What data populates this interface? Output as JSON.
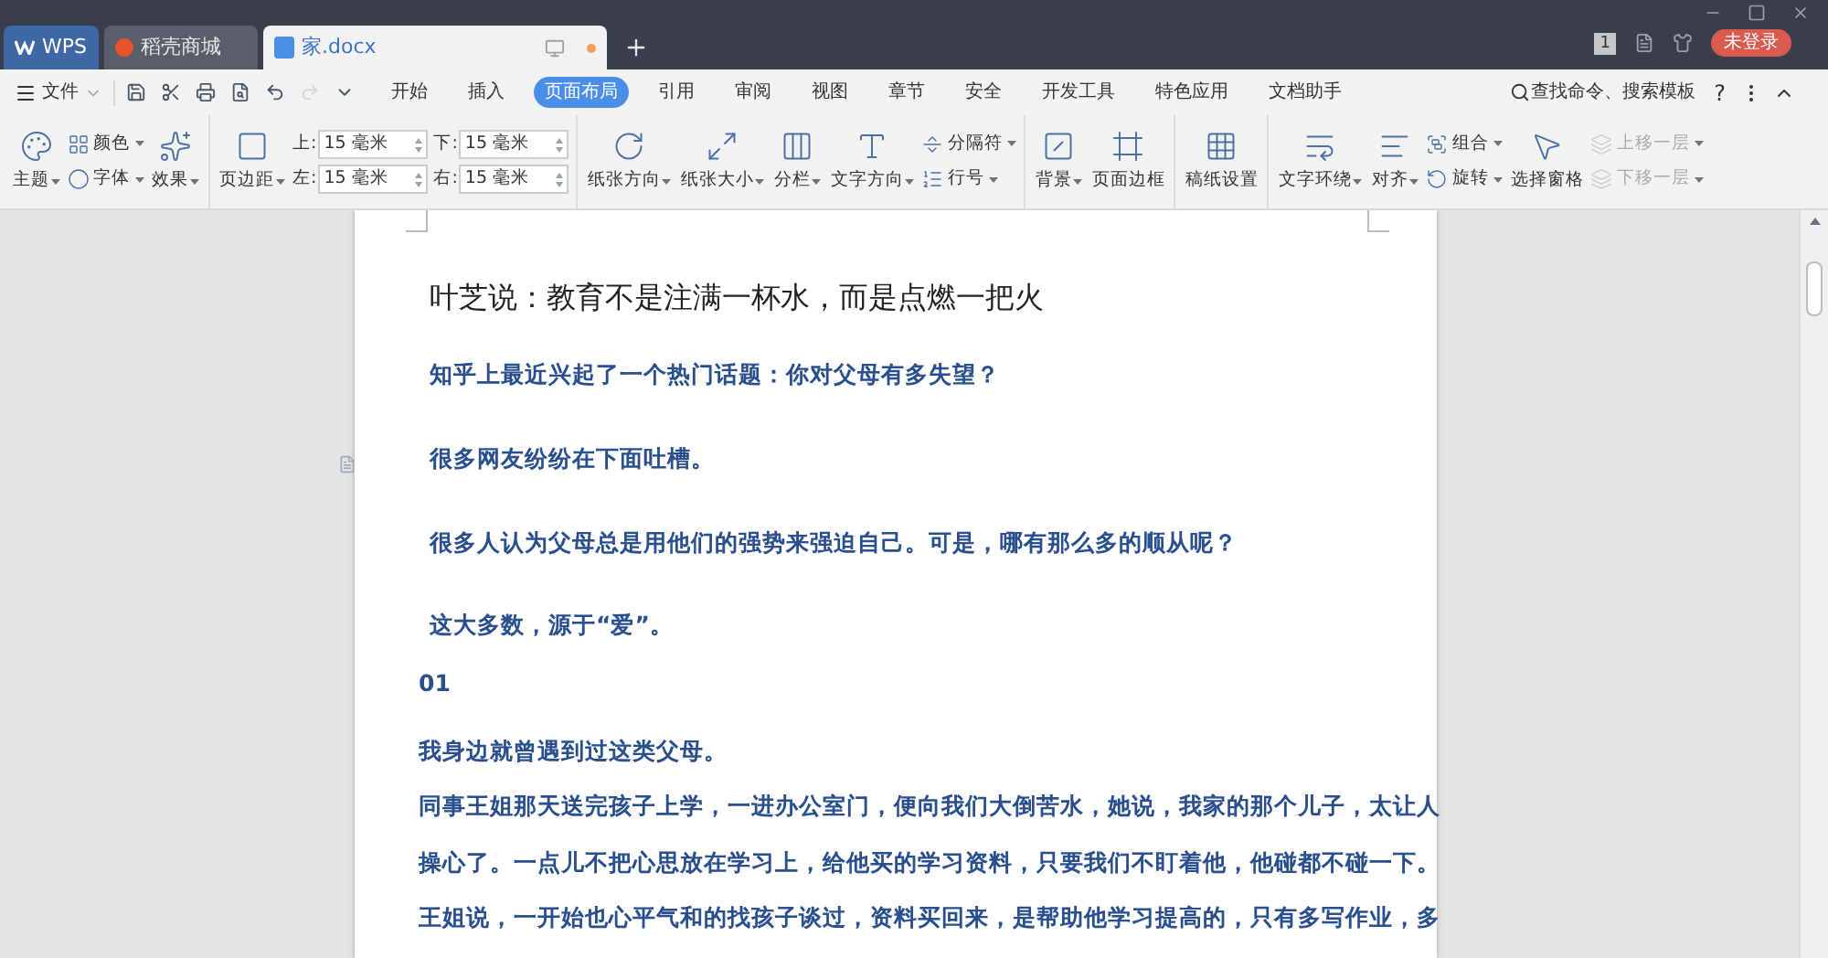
{
  "title_tabs": [
    {
      "label": "WPS",
      "selected": false,
      "kind": "home"
    },
    {
      "label": "稻壳商城",
      "selected": false,
      "kind": "store"
    },
    {
      "label": "家.docx",
      "selected": true,
      "kind": "doc"
    }
  ],
  "title_right": {
    "badge": "1",
    "login": "未登录"
  },
  "menu": {
    "file": "文件",
    "tabs": [
      {
        "label": "开始",
        "selected": false
      },
      {
        "label": "插入",
        "selected": false
      },
      {
        "label": "页面布局",
        "selected": true
      },
      {
        "label": "引用",
        "selected": false
      },
      {
        "label": "审阅",
        "selected": false
      },
      {
        "label": "视图",
        "selected": false
      },
      {
        "label": "章节",
        "selected": false
      },
      {
        "label": "安全",
        "selected": false
      },
      {
        "label": "开发工具",
        "selected": false
      },
      {
        "label": "特色应用",
        "selected": false
      },
      {
        "label": "文档助手",
        "selected": false
      }
    ],
    "search": "查找命令、搜索模板",
    "help": "?"
  },
  "ribbon": [
    {
      "columns": [
        {
          "kind": "large",
          "label": "主题",
          "dropdown": true
        },
        {
          "kind": "stack",
          "items": [
            {
              "label": "颜色",
              "dropdown": true,
              "disabled": false
            },
            {
              "label": "字体",
              "dropdown": true,
              "disabled": false
            }
          ]
        },
        {
          "kind": "large",
          "label": "效果",
          "dropdown": true
        }
      ]
    },
    {
      "columns": [
        {
          "kind": "large",
          "label": "页边距",
          "dropdown": true
        },
        {
          "kind": "fields",
          "items": [
            {
              "label": "上:",
              "value": "15 毫米"
            },
            {
              "label": "左:",
              "value": "15 毫米"
            }
          ]
        },
        {
          "kind": "fields",
          "items": [
            {
              "label": "下:",
              "value": "15 毫米"
            },
            {
              "label": "右:",
              "value": "15 毫米"
            }
          ]
        }
      ]
    },
    {
      "columns": [
        {
          "kind": "large",
          "label": "纸张方向",
          "dropdown": true
        },
        {
          "kind": "large",
          "label": "纸张大小",
          "dropdown": true
        },
        {
          "kind": "large",
          "label": "分栏",
          "dropdown": true
        },
        {
          "kind": "large",
          "label": "文字方向",
          "dropdown": true
        },
        {
          "kind": "stack",
          "items": [
            {
              "label": "分隔符",
              "dropdown": true,
              "disabled": false
            },
            {
              "label": "行号",
              "dropdown": true,
              "disabled": false
            }
          ]
        }
      ]
    },
    {
      "columns": [
        {
          "kind": "large",
          "label": "背景",
          "dropdown": true
        },
        {
          "kind": "large",
          "label": "页面边框",
          "dropdown": false
        }
      ]
    },
    {
      "columns": [
        {
          "kind": "large",
          "label": "稿纸设置",
          "dropdown": false
        }
      ]
    },
    {
      "columns": [
        {
          "kind": "large",
          "label": "文字环绕",
          "dropdown": true
        },
        {
          "kind": "large",
          "label": "对齐",
          "dropdown": true
        },
        {
          "kind": "stack",
          "items": [
            {
              "label": "组合",
              "dropdown": true,
              "disabled": false
            },
            {
              "label": "旋转",
              "dropdown": true,
              "disabled": false
            }
          ]
        },
        {
          "kind": "large",
          "label": "选择窗格",
          "dropdown": false
        },
        {
          "kind": "stack",
          "items": [
            {
              "label": "上移一层",
              "dropdown": true,
              "disabled": true
            },
            {
              "label": "下移一层",
              "dropdown": true,
              "disabled": true
            }
          ]
        }
      ]
    }
  ],
  "document": {
    "paragraphs": [
      {
        "kind": "heading",
        "lines": [
          "叶芝说：教育不是注满一杯水，而是点燃一把火"
        ]
      },
      {
        "kind": "body",
        "lines": [
          "知乎上最近兴起了一个热门话题：你对父母有多失望？"
        ]
      },
      {
        "kind": "body",
        "lines": [
          "很多网友纷纷在下面吐槽。"
        ]
      },
      {
        "kind": "body",
        "lines": [
          "很多人认为父母总是用他们的强势来强迫自己。可是，哪有那么多的顺从呢？"
        ]
      },
      {
        "kind": "body",
        "lines": [
          "这大多数，源于“爱”。"
        ]
      },
      {
        "kind": "number",
        "lines": [
          "01"
        ]
      },
      {
        "kind": "tight",
        "lines": [
          "我身边就曾遇到过这类父母。"
        ]
      },
      {
        "kind": "tight",
        "lines": [
          "同事王姐那天送完孩子上学，一进办公室门，便向我们大倒苦水，她说，我家的那个儿子，太让人",
          "操心了。一点儿不把心思放在学习上，给他买的学习资料，只要我们不盯着他，他碰都不碰一下。",
          "王姐说，一开始也心平气和的找孩子谈过，资料买回来，是帮助他学习提高的，只有多写作业，多"
        ]
      }
    ]
  }
}
